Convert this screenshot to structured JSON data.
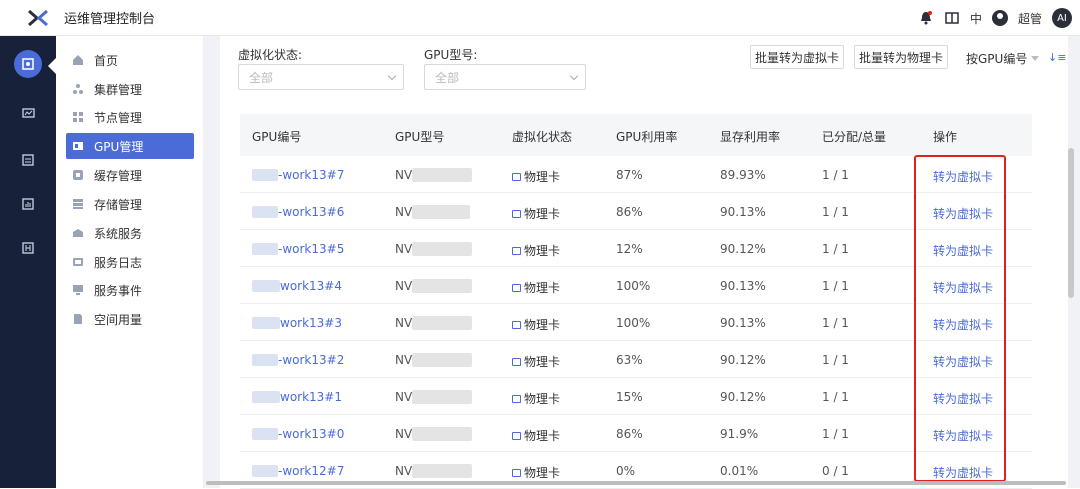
{
  "app": {
    "title": "运维管理控制台"
  },
  "header": {
    "lang": "中",
    "user": "超管",
    "badge": "AI"
  },
  "sidebar": {
    "items": [
      {
        "label": "首页"
      },
      {
        "label": "集群管理"
      },
      {
        "label": "节点管理"
      },
      {
        "label": "GPU管理"
      },
      {
        "label": "缓存管理"
      },
      {
        "label": "存储管理"
      },
      {
        "label": "系统服务"
      },
      {
        "label": "服务日志"
      },
      {
        "label": "服务事件"
      },
      {
        "label": "空间用量"
      }
    ],
    "active_index": 3
  },
  "filters": {
    "virt_label": "虚拟化状态:",
    "virt_value": "全部",
    "gpu_label": "GPU型号:",
    "gpu_value": "全部"
  },
  "toolbar": {
    "batch_virtual": "批量转为虚拟卡",
    "batch_physical": "批量转为物理卡",
    "sort_label": "按GPU编号",
    "sort_icon": "↓≡"
  },
  "table": {
    "headers": [
      "GPU编号",
      "GPU型号",
      "虚拟化状态",
      "GPU利用率",
      "显存利用率",
      "已分配/总量",
      "操作"
    ],
    "rows": [
      {
        "id": "-work13#7",
        "model": "NV",
        "status": "物理卡",
        "gpu_util": "87%",
        "mem_util": "89.93%",
        "alloc": "1 / 1",
        "action": "转为虚拟卡"
      },
      {
        "id": "-work13#6",
        "model": "NV",
        "status": "物理卡",
        "gpu_util": "86%",
        "mem_util": "90.13%",
        "alloc": "1 / 1",
        "action": "转为虚拟卡"
      },
      {
        "id": "-work13#5",
        "model": "NV",
        "status": "物理卡",
        "gpu_util": "12%",
        "mem_util": "90.12%",
        "alloc": "1 / 1",
        "action": "转为虚拟卡"
      },
      {
        "id": "work13#4",
        "model": "NV",
        "status": "物理卡",
        "gpu_util": "100%",
        "mem_util": "90.13%",
        "alloc": "1 / 1",
        "action": "转为虚拟卡"
      },
      {
        "id": "work13#3",
        "model": "NV",
        "status": "物理卡",
        "gpu_util": "100%",
        "mem_util": "90.13%",
        "alloc": "1 / 1",
        "action": "转为虚拟卡"
      },
      {
        "id": "-work13#2",
        "model": "NV",
        "status": "物理卡",
        "gpu_util": "63%",
        "mem_util": "90.12%",
        "alloc": "1 / 1",
        "action": "转为虚拟卡"
      },
      {
        "id": "work13#1",
        "model": "NV",
        "status": "物理卡",
        "gpu_util": "15%",
        "mem_util": "90.12%",
        "alloc": "1 / 1",
        "action": "转为虚拟卡"
      },
      {
        "id": "-work13#0",
        "model": "NV",
        "status": "物理卡",
        "gpu_util": "86%",
        "mem_util": "91.9%",
        "alloc": "1 / 1",
        "action": "转为虚拟卡"
      },
      {
        "id": "-work12#7",
        "model": "NV",
        "status": "物理卡",
        "gpu_util": "0%",
        "mem_util": "0.01%",
        "alloc": "0 / 1",
        "action": "转为虚拟卡"
      }
    ]
  },
  "colors": {
    "accent": "#4a6bd8",
    "rail": "#18213a",
    "highlight": "#e02020"
  }
}
